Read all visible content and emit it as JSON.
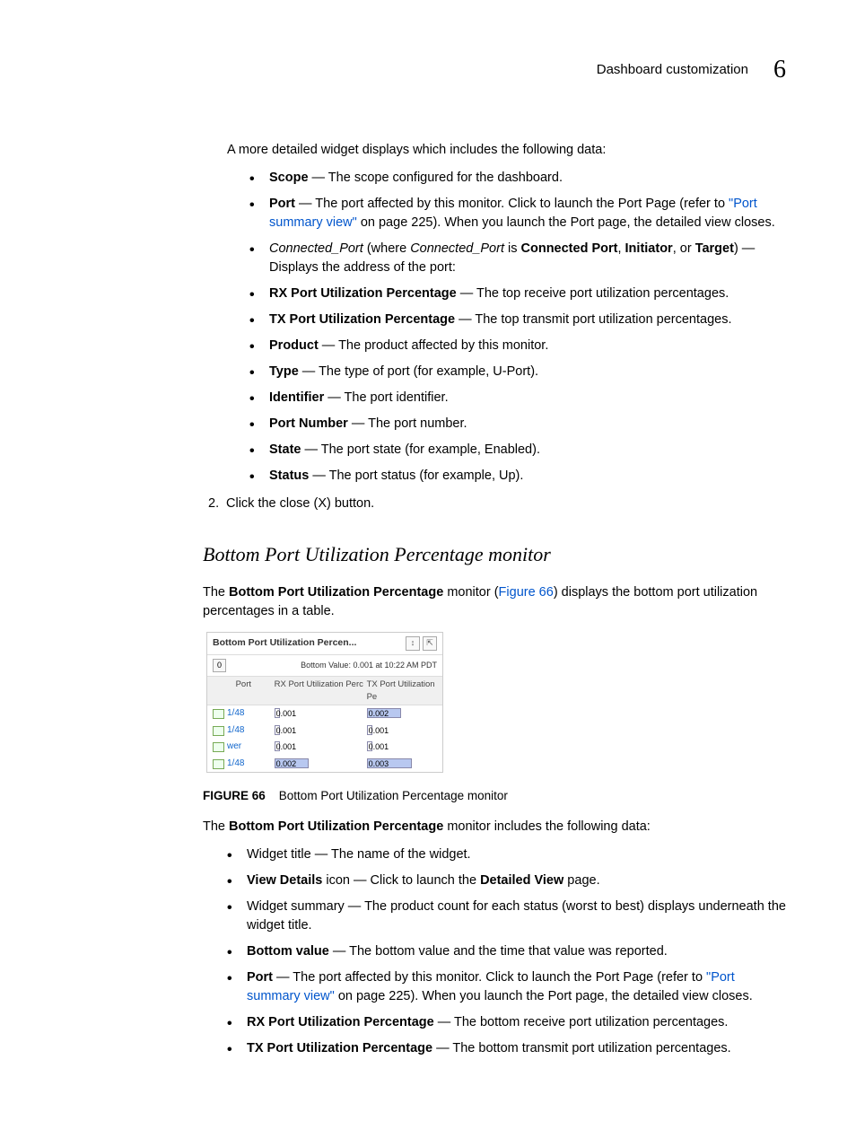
{
  "header": {
    "section": "Dashboard customization",
    "chapter": "6"
  },
  "intro": "A more detailed widget displays which includes the following data:",
  "list1": {
    "scope": {
      "term": "Scope",
      "desc": " — The scope configured for the dashboard."
    },
    "port": {
      "term": "Port",
      "desc_a": " — The port affected by this monitor. Click to launch the Port Page (refer to ",
      "link": "\"Port summary view\"",
      "desc_b": " on page 225). When you launch the Port page, the detailed view closes."
    },
    "cport": {
      "term": "Connected_Port",
      "mid": " (where ",
      "term2": "Connected_Port",
      "is": " is ",
      "b1": "Connected Port",
      "c1": ", ",
      "b2": "Initiator",
      "c2": ", or ",
      "b3": "Target",
      "tail": ") — Displays the address of the port:"
    },
    "rx": {
      "term": "RX Port Utilization Percentage",
      "desc": " — The top receive port utilization percentages."
    },
    "tx": {
      "term": "TX Port Utilization Percentage",
      "desc": " — The top transmit port utilization percentages."
    },
    "product": {
      "term": "Product",
      "desc": " — The product affected by this monitor."
    },
    "type": {
      "term": "Type",
      "desc": " — The type of port (for example, U-Port)."
    },
    "identifier": {
      "term": "Identifier",
      "desc": " — The port identifier."
    },
    "portnum": {
      "term": "Port Number",
      "desc": " — The port number."
    },
    "state": {
      "term": "State",
      "desc": " — The port state (for example, Enabled)."
    },
    "status": {
      "term": "Status",
      "desc": " — The port status (for example, Up)."
    }
  },
  "step2": {
    "num": "2.",
    "text": "Click the close (X) button."
  },
  "section_h": "Bottom Port Utilization Percentage monitor",
  "sec_para": {
    "a": "The ",
    "b": "Bottom Port Utilization Percentage",
    "c": " monitor (",
    "link": "Figure 66",
    "d": ") displays the bottom port utilization percentages in a table."
  },
  "widget": {
    "title": "Bottom Port Utilization Percen...",
    "count": "0",
    "bottom_value": "Bottom Value: 0.001 at 10:22 AM PDT",
    "cols": {
      "c1": "Port",
      "c2": "RX Port Utilization Perc",
      "c3": "TX Port Utilization Pe"
    },
    "rows": [
      {
        "port": "1/48",
        "rx": "0.001",
        "rx_fill": false,
        "tx": "0.002",
        "tx_fill": true
      },
      {
        "port": "1/48",
        "rx": "0.001",
        "rx_fill": false,
        "tx": "0.001",
        "tx_fill": false
      },
      {
        "port": "wer",
        "rx": "0.001",
        "rx_fill": false,
        "tx": "0.001",
        "tx_fill": false
      },
      {
        "port": "1/48",
        "rx": "0.002",
        "rx_fill": true,
        "tx": "0.003",
        "tx_fill": true
      }
    ]
  },
  "fig_caption": {
    "lbl": "FIGURE 66",
    "txt": "Bottom Port Utilization Percentage monitor"
  },
  "sec_para2": {
    "a": "The ",
    "b": "Bottom Port Utilization Percentage",
    "c": " monitor includes the following data:"
  },
  "list2": {
    "wt": "Widget title — The name of the widget.",
    "vd": {
      "term": "View Details",
      "mid": " icon — Click to launch the ",
      "b": "Detailed View",
      "tail": " page."
    },
    "ws": "Widget summary — The product count for each status (worst to best) displays underneath the widget title.",
    "bv": {
      "term": "Bottom value",
      "desc": " — The bottom value and the time that value was reported."
    },
    "port": {
      "term": "Port",
      "desc_a": " — The port affected by this monitor. Click to launch the Port Page (refer to ",
      "link": "\"Port summary view\"",
      "desc_b": " on page 225). When you launch the Port page, the detailed view closes."
    },
    "rx": {
      "term": "RX Port Utilization Percentage",
      "desc": " — The bottom receive port utilization percentages."
    },
    "tx": {
      "term": "TX Port Utilization Percentage",
      "desc": " — The bottom transmit port utilization percentages."
    }
  }
}
